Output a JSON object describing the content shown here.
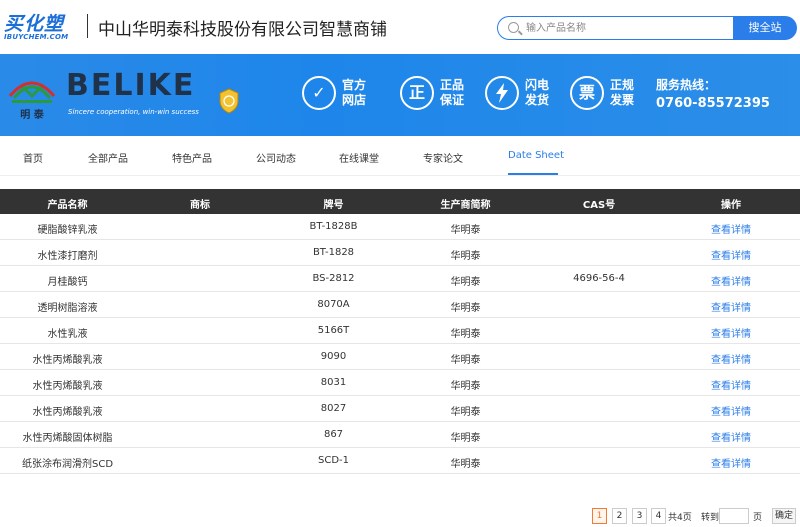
{
  "header": {
    "site_logo_main": "买化塑",
    "site_logo_sub": "IBUYCHEM.COM",
    "shop_title": "中山华明泰科技股份有限公司智慧商铺",
    "search_placeholder": "输入产品名称",
    "search_button": "搜全站"
  },
  "banner": {
    "brand_name": "BELIKE",
    "brand_slogan": "Sincere cooperation, win-win success",
    "brand_mark_caption": "明 泰",
    "features": [
      {
        "icon": "check-icon",
        "glyph": "✓",
        "line1": "官方",
        "line2": "网店"
      },
      {
        "icon": "genuine-icon",
        "glyph": "正",
        "line1": "正品",
        "line2": "保证"
      },
      {
        "icon": "lightning-icon",
        "glyph": "⚡",
        "line1": "闪电",
        "line2": "发货"
      },
      {
        "icon": "invoice-icon",
        "glyph": "票",
        "line1": "正规",
        "line2": "发票"
      }
    ],
    "hotline_label": "服务热线：",
    "hotline_number": "0760-85572395"
  },
  "nav": {
    "items": [
      "首页",
      "全部产品",
      "特色产品",
      "公司动态",
      "在线课堂",
      "专家论文",
      "Date Sheet"
    ],
    "active": "Date Sheet"
  },
  "table": {
    "headers": [
      "产品名称",
      "商标",
      "牌号",
      "生产商简称",
      "CAS号",
      "操作"
    ],
    "rows": [
      [
        "硬脂酸锌乳液",
        "",
        "BT-1828B",
        "华明泰",
        "",
        "查看详情"
      ],
      [
        "水性漆打磨剂",
        "",
        "BT-1828",
        "华明泰",
        "",
        "查看详情"
      ],
      [
        "月桂酸钙",
        "",
        "BS-2812",
        "华明泰",
        "4696-56-4",
        "查看详情"
      ],
      [
        "透明树脂溶液",
        "",
        "8070A",
        "华明泰",
        "",
        "查看详情"
      ],
      [
        "水性乳液",
        "",
        "5166T",
        "华明泰",
        "",
        "查看详情"
      ],
      [
        "水性丙烯酸乳液",
        "",
        "9090",
        "华明泰",
        "",
        "查看详情"
      ],
      [
        "水性丙烯酸乳液",
        "",
        "8031",
        "华明泰",
        "",
        "查看详情"
      ],
      [
        "水性丙烯酸乳液",
        "",
        "8027",
        "华明泰",
        "",
        "查看详情"
      ],
      [
        "水性丙烯酸固体树脂",
        "",
        "867",
        "华明泰",
        "",
        "查看详情"
      ],
      [
        "纸张涂布润滑剂SCD",
        "",
        "SCD-1",
        "华明泰",
        "",
        "查看详情"
      ]
    ]
  },
  "pagination": {
    "pages": [
      "1",
      "2",
      "3",
      "4"
    ],
    "current": "1",
    "total_text": "共4页",
    "goto_label": "转到",
    "page_unit": "页",
    "confirm": "确定"
  },
  "colors": {
    "accent": "#2b7de9",
    "banner": "#1e86ea",
    "table_header": "#333333",
    "pager_active": "#f47a30"
  }
}
